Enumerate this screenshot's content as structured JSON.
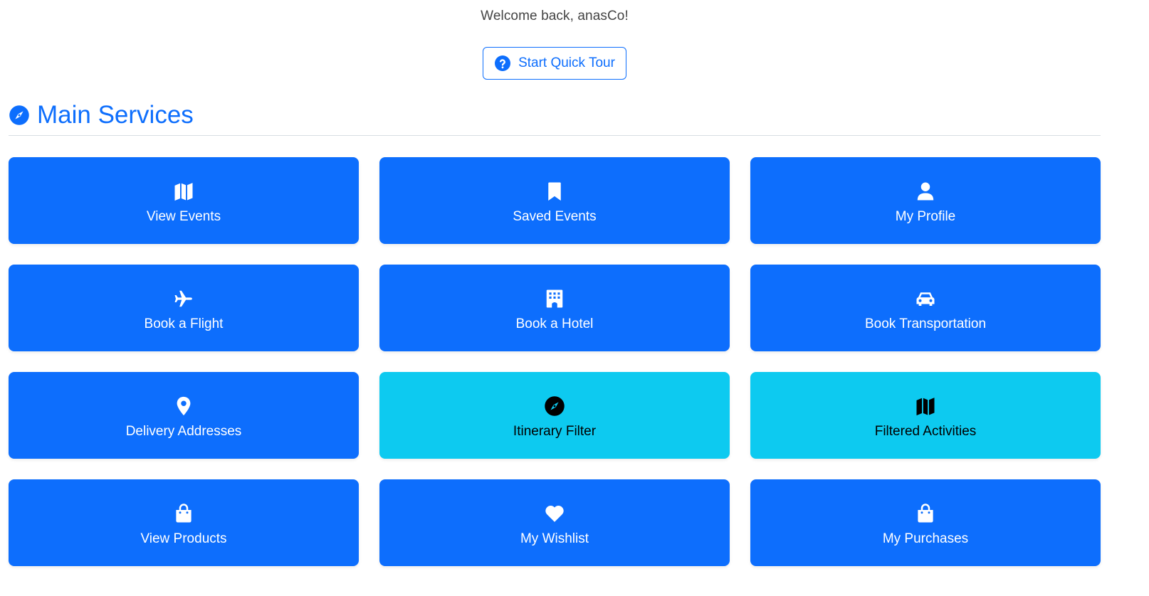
{
  "header": {
    "welcome_text": "Welcome back, anasCo!",
    "tour_button_label": "Start Quick Tour"
  },
  "section": {
    "title": "Main Services"
  },
  "colors": {
    "primary": "#0d6efd",
    "info": "#0dcaf0"
  },
  "cards": [
    {
      "label": "View Events",
      "icon": "map-icon",
      "style": "primary"
    },
    {
      "label": "Saved Events",
      "icon": "bookmark-icon",
      "style": "primary"
    },
    {
      "label": "My Profile",
      "icon": "user-icon",
      "style": "primary"
    },
    {
      "label": "Book a Flight",
      "icon": "plane-icon",
      "style": "primary"
    },
    {
      "label": "Book a Hotel",
      "icon": "hotel-icon",
      "style": "primary"
    },
    {
      "label": "Book Transportation",
      "icon": "car-icon",
      "style": "primary"
    },
    {
      "label": "Delivery Addresses",
      "icon": "map-marker-icon",
      "style": "primary"
    },
    {
      "label": "Itinerary Filter",
      "icon": "compass-icon",
      "style": "info"
    },
    {
      "label": "Filtered Activities",
      "icon": "map-icon",
      "style": "info"
    },
    {
      "label": "View Products",
      "icon": "shopping-bag-icon",
      "style": "primary"
    },
    {
      "label": "My Wishlist",
      "icon": "heart-icon",
      "style": "primary"
    },
    {
      "label": "My Purchases",
      "icon": "shopping-bag-icon",
      "style": "primary"
    }
  ]
}
